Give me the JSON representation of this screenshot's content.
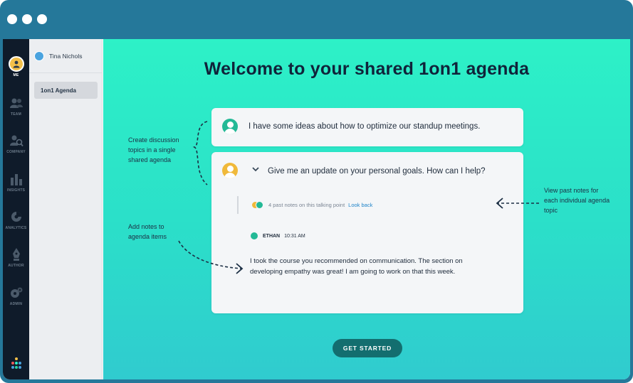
{
  "rail": {
    "items": [
      {
        "label": "ME",
        "icon": "user-avatar-icon"
      },
      {
        "label": "TEAM",
        "icon": "team-icon"
      },
      {
        "label": "COMPANY",
        "icon": "company-search-icon"
      },
      {
        "label": "INSIGHTS",
        "icon": "bar-chart-icon"
      },
      {
        "label": "ANALYTICS",
        "icon": "pie-chart-icon"
      },
      {
        "label": "AUTHOR",
        "icon": "pen-icon"
      },
      {
        "label": "ADMIN",
        "icon": "gear-icon"
      }
    ]
  },
  "sidebar": {
    "user_name": "Tina Nichols",
    "items": [
      {
        "label": "1on1 Agenda"
      }
    ]
  },
  "main": {
    "title": "Welcome to your shared 1on1 agenda",
    "card1": {
      "text": "I have some ideas about how to optimize our standup meetings."
    },
    "card2": {
      "text": "Give me an update on your personal goals. How can I help?",
      "history_text": "4 past notes on this talking point",
      "history_link": "Look back",
      "note_author": "ETHAN",
      "note_time": "10:31 AM",
      "note_body": "I took the course you recommended on communication. The section on developing empathy was great! I am going to work on that this week."
    },
    "annotations": {
      "left_top": "Create discussion topics in a single shared agenda",
      "left_bottom": "Add notes to agenda items",
      "right": "View past notes for each individual agenda topic"
    },
    "cta_label": "GET STARTED"
  },
  "colors": {
    "frame": "#25789a",
    "rail": "#0f1b2a",
    "accent_teal": "#2df1c7",
    "cta": "#136e6f",
    "link": "#1f84c9"
  }
}
